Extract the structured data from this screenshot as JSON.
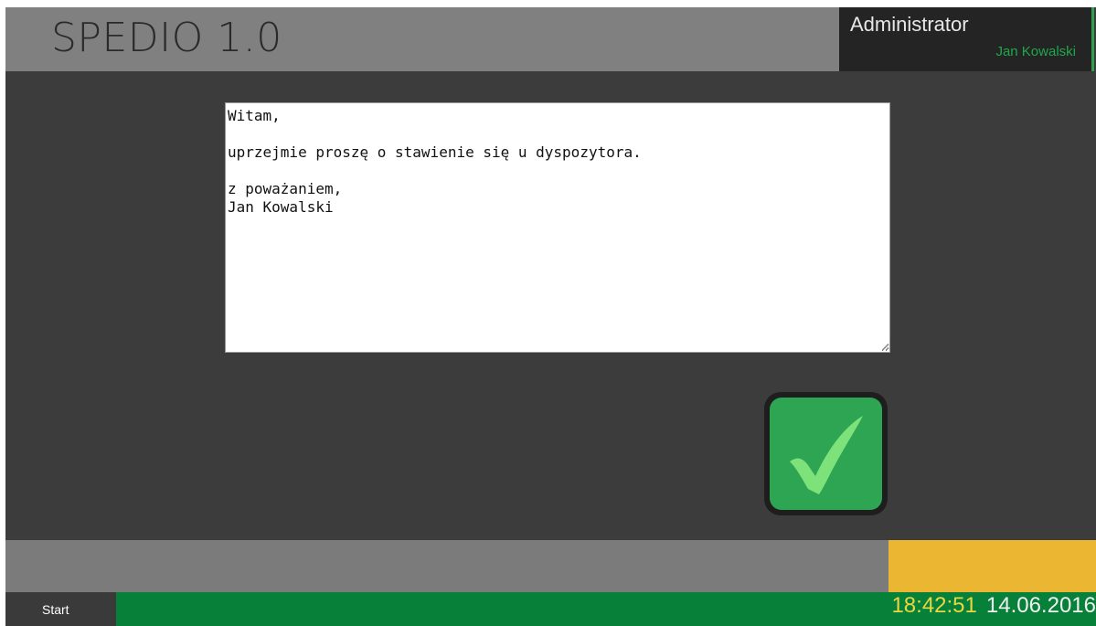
{
  "header": {
    "app_title": "SPEDIO 1.0"
  },
  "user": {
    "role": "Administrator",
    "name": "Jan Kowalski"
  },
  "message": {
    "text": "Witam,\n\nuprzejmie proszę o stawienie się u dyspozytora.\n\nz poważaniem,\nJan Kowalski"
  },
  "confirm": {
    "icon": "checkmark-icon"
  },
  "taskbar": {
    "start_label": "Start",
    "time": "18:42:51",
    "date": "14.06.2016"
  },
  "colors": {
    "accent_green": "#07813a",
    "confirm_green": "#2ea553",
    "check_green": "#7ee27a",
    "warning_yellow": "#ebb631",
    "clock_yellow": "#e9d640"
  }
}
